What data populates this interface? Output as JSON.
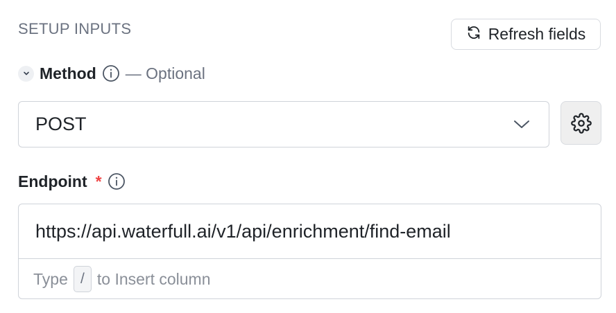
{
  "section": {
    "title": "SETUP INPUTS"
  },
  "refresh": {
    "label": "Refresh fields",
    "icon": "refresh-icon"
  },
  "method": {
    "label": "Method",
    "optional_text": "— Optional",
    "value": "POST"
  },
  "endpoint": {
    "label": "Endpoint",
    "required_marker": "*",
    "value": "https://api.waterfull.ai/v1/api/enrichment/find-email",
    "hint_prefix": "Type",
    "hint_key": "/",
    "hint_suffix": "to Insert column"
  },
  "colors": {
    "required": "#ef4444",
    "muted": "#6b7280",
    "border": "#cfd3d9"
  }
}
